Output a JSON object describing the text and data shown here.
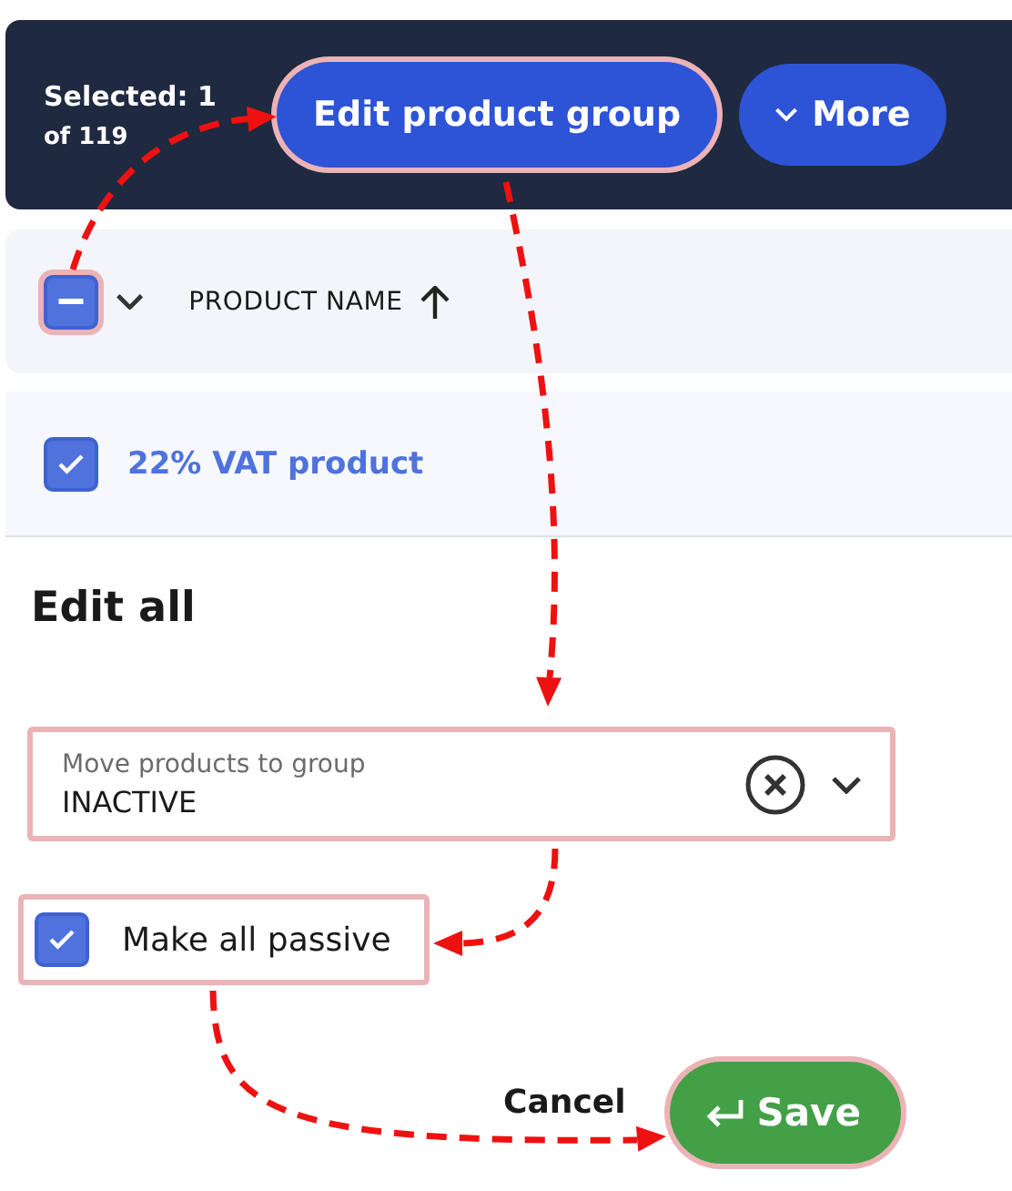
{
  "toolbar": {
    "selected_label": "Selected: 1",
    "total_label": "of 119",
    "buttons": [
      {
        "label": "Edit product group",
        "kind": "primary",
        "highlighted": true
      },
      {
        "label": "More",
        "kind": "menu",
        "highlighted": false
      }
    ]
  },
  "table": {
    "header": {
      "checkbox": {
        "checked": true,
        "indeterminate": true,
        "highlighted": true
      },
      "column": "PRODUCT NAME",
      "sort_ascending": true
    },
    "rows": [
      {
        "name": "22% VAT product",
        "checked": true
      }
    ]
  },
  "edit_panel": {
    "title": "Edit all",
    "group_field": {
      "label": "Move products to group",
      "value": "INACTIVE",
      "highlighted": true
    },
    "passive_option": {
      "label": "Make all passive",
      "checked": true,
      "highlighted": true
    },
    "cancel": "Cancel",
    "save": {
      "label": "Save",
      "highlighted": true
    }
  }
}
